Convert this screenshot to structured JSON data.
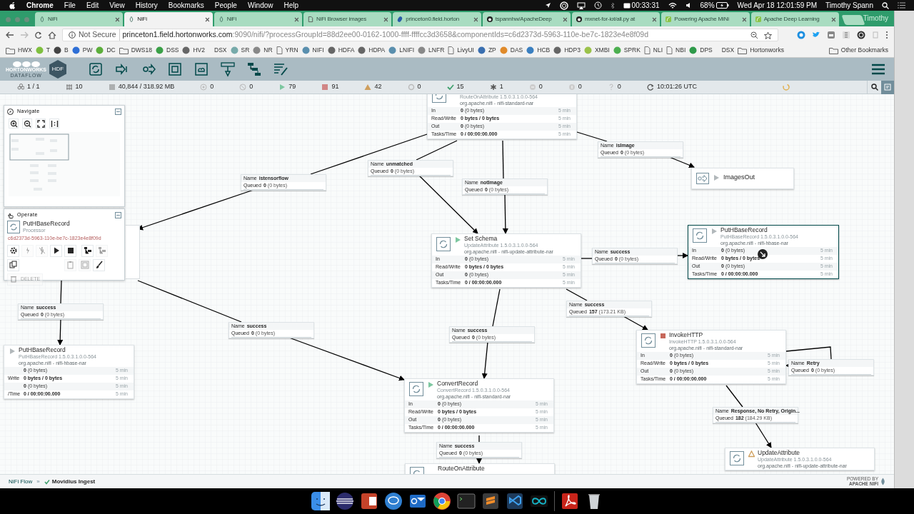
{
  "menubar": {
    "items": [
      "Chrome",
      "File",
      "Edit",
      "View",
      "History",
      "Bookmarks",
      "People",
      "Window",
      "Help"
    ],
    "timer": "00:33:31",
    "battery": "68%",
    "datetime": "Wed Apr 18  12:01:59 PM",
    "user": "Timothy Spann"
  },
  "tabs": [
    {
      "label": "NiFi",
      "selected": false,
      "kind": "nifi"
    },
    {
      "label": "NiFi",
      "selected": true,
      "kind": "nifi"
    },
    {
      "label": "NiFi",
      "selected": false,
      "kind": "nifi"
    },
    {
      "label": "NiFi Browser images",
      "selected": false,
      "kind": "page"
    },
    {
      "label": "princeton0.field.horton",
      "selected": false,
      "kind": "site"
    },
    {
      "label": "tspannhw/ApacheDeep",
      "selected": false,
      "kind": "github"
    },
    {
      "label": "mxnet-for-iot/all.py at",
      "selected": false,
      "kind": "github"
    },
    {
      "label": "Powering Apache MiNi",
      "selected": false,
      "kind": "leaf"
    },
    {
      "label": "Apache Deep Learning",
      "selected": false,
      "kind": "leaf"
    }
  ],
  "profile": "Timothy",
  "address": {
    "security": "Not Secure",
    "host": "princeton1.field.hortonworks.com",
    "path": ":9090/nifi/?processGroupId=88d2ee00-0162-1000-ffff-ffffcc3d3658&componentIds=c6d2373d-5963-110e-be7c-1823e4e8f09d"
  },
  "bookmarks": [
    {
      "label": "HWX",
      "kind": "folder"
    },
    {
      "label": "T",
      "kind": "site",
      "color": "#7fbf3f"
    },
    {
      "label": "B",
      "kind": "site",
      "color": "#444444"
    },
    {
      "label": "PW",
      "kind": "site",
      "color": "#2f6fd6"
    },
    {
      "label": "DC",
      "kind": "site",
      "color": "#5cae3b"
    },
    {
      "label": "DWS18",
      "kind": "folder"
    },
    {
      "label": "DSS",
      "kind": "site",
      "color": "#3aa047"
    },
    {
      "label": "HV2",
      "kind": "site",
      "color": "#666666"
    },
    {
      "label": "DSX",
      "kind": "text"
    },
    {
      "label": "SR",
      "kind": "site",
      "color": "#77aaaa"
    },
    {
      "label": "NR",
      "kind": "site",
      "color": "#888888"
    },
    {
      "label": "YRN",
      "kind": "page"
    },
    {
      "label": "NIFI",
      "kind": "site",
      "color": "#5a8fae"
    },
    {
      "label": "HDFA",
      "kind": "site",
      "color": "#666666"
    },
    {
      "label": "HDPA",
      "kind": "site",
      "color": "#666666"
    },
    {
      "label": "LNIFI",
      "kind": "site",
      "color": "#5a8fae"
    },
    {
      "label": "LNFR",
      "kind": "site",
      "color": "#888888"
    },
    {
      "label": "LivyUI",
      "kind": "page"
    },
    {
      "label": "ZP",
      "kind": "site",
      "color": "#3a6fb0"
    },
    {
      "label": "DAS",
      "kind": "site",
      "color": "#e08a2a"
    },
    {
      "label": "HCB",
      "kind": "site",
      "color": "#3a7fc0"
    },
    {
      "label": "HDP3",
      "kind": "site",
      "color": "#666666"
    },
    {
      "label": "XMBI",
      "kind": "site",
      "color": "#9bc24a"
    },
    {
      "label": "SPRK",
      "kind": "site",
      "color": "#4caf50"
    },
    {
      "label": "NLI",
      "kind": "page"
    },
    {
      "label": "NBI",
      "kind": "page"
    },
    {
      "label": "DPS",
      "kind": "site",
      "color": "#2e9a4a"
    },
    {
      "label": "DSX",
      "kind": "text"
    },
    {
      "label": "Hortonworks",
      "kind": "folder"
    },
    {
      "label": "Other Bookmarks",
      "kind": "folder"
    }
  ],
  "nifi": {
    "brand": "HORTONWORKS",
    "product": "DATAFLOW",
    "badge": "HDF"
  },
  "status_bar": [
    {
      "kind": "cluster",
      "text": "1 / 1"
    },
    {
      "kind": "threads",
      "text": "10"
    },
    {
      "kind": "queue",
      "text": "40,844 / 318.92 MB"
    },
    {
      "kind": "transmitting",
      "text": "0"
    },
    {
      "kind": "not-transmitting",
      "text": "0"
    },
    {
      "kind": "running",
      "text": "79"
    },
    {
      "kind": "stopped",
      "text": "91"
    },
    {
      "kind": "invalid",
      "text": "42"
    },
    {
      "kind": "disabled",
      "text": "0"
    },
    {
      "kind": "up-to-date",
      "text": "15"
    },
    {
      "kind": "modified",
      "text": "1"
    },
    {
      "kind": "stale",
      "text": "0"
    },
    {
      "kind": "stale-modified",
      "text": "0"
    },
    {
      "kind": "unknown",
      "text": "0"
    },
    {
      "kind": "refresh",
      "text": "10:01:26 UTC"
    }
  ],
  "navigate": {
    "title": "Navigate"
  },
  "operate": {
    "title": "Operate",
    "name": "PutHBaseRecord",
    "type": "Processor",
    "id": "c6d2373d-5963-110e-be7c-1823e4e8f09d",
    "buttons": [
      {
        "kind": "configure",
        "disabled": false
      },
      {
        "kind": "enable",
        "disabled": true
      },
      {
        "kind": "disable",
        "disabled": true
      },
      {
        "kind": "start",
        "disabled": false
      },
      {
        "kind": "stop",
        "disabled": false
      },
      {
        "kind": "template",
        "disabled": false
      },
      {
        "kind": "template-upload",
        "disabled": true
      },
      {
        "kind": "copy",
        "disabled": false
      },
      {
        "kind": "paste",
        "disabled": true
      },
      {
        "kind": "group",
        "disabled": true
      },
      {
        "kind": "color",
        "disabled": false
      },
      {
        "kind": "delete",
        "label": "DELETE",
        "disabled": true
      }
    ]
  },
  "processors": [
    {
      "kind": "processor",
      "selected": false,
      "type": "RouteOnAttribute 1.5.0.3.1.0.0-564",
      "bundle": "org.apache.nifi - nifi-standard-nar",
      "rows": [
        {
          "label": "In",
          "count": "0",
          "detail": "(0 bytes)",
          "time": "5 min"
        },
        {
          "label": "Read/Write",
          "count": "0 bytes / 0 bytes",
          "time": "5 min"
        },
        {
          "label": "Out",
          "count": "0",
          "detail": "(0 bytes)",
          "time": "5 min"
        },
        {
          "label": "Tasks/Time",
          "count": "0 / 00:00:00.000",
          "time": "5 min"
        }
      ]
    },
    {
      "kind": "processor",
      "selected": false,
      "running": false,
      "stopped": false,
      "invalid": false,
      "name": "PutHBaseRecord",
      "type": "PutHBaseRecord 1.5.0.3.1.0.0-564",
      "bundle": "org.apache.nifi - nifi-hbase-nar",
      "rows": [
        {
          "count": "0",
          "detail": "(0 bytes)",
          "time": "5 min"
        },
        {
          "label": "Write",
          "count": "0 bytes / 0 bytes",
          "time": "5 min"
        },
        {
          "count": "0",
          "detail": "(0 bytes)",
          "time": "5 min"
        },
        {
          "label": "/Time",
          "count": "0 / 00:00:00.000",
          "time": "5 min"
        }
      ]
    },
    {
      "kind": "processor",
      "selected": false,
      "running": true,
      "stopped": false,
      "invalid": false,
      "name": "Set Schema",
      "type": "UpdateAttribute 1.5.0.3.1.0.0-564",
      "bundle": "org.apache.nifi - nifi-update-attribute-nar",
      "rows": [
        {
          "label": "In",
          "count": "0",
          "detail": "(0 bytes)",
          "time": "5 min"
        },
        {
          "label": "Read/Write",
          "count": "0 bytes / 0 bytes",
          "time": "5 min"
        },
        {
          "label": "Out",
          "count": "0",
          "detail": "(0 bytes)",
          "time": "5 min"
        },
        {
          "label": "Tasks/Time",
          "count": "0 / 00:00:00.000",
          "time": "5 min"
        }
      ]
    },
    {
      "kind": "port",
      "selected": false,
      "running": false,
      "stopped": false,
      "invalid": false,
      "name": "ImagesOut"
    },
    {
      "kind": "processor",
      "selected": true,
      "running": false,
      "stopped": false,
      "invalid": false,
      "name": "PutHBaseRecord",
      "type": "PutHBaseRecord 1.5.0.3.1.0.0-564",
      "bundle": "org.apache.nifi - nifi-hbase-nar",
      "rows": [
        {
          "label": "In",
          "count": "0",
          "detail": "(0 bytes)",
          "time": "5 min"
        },
        {
          "label": "Read/Write",
          "count": "0 bytes / 0 bytes",
          "time": "5 min"
        },
        {
          "label": "Out",
          "count": "0",
          "detail": "(0 bytes)",
          "time": "5 min"
        },
        {
          "label": "Tasks/Time",
          "count": "0 / 00:00:00.000",
          "time": "5 min"
        }
      ]
    },
    {
      "kind": "processor",
      "selected": false,
      "running": false,
      "stopped": true,
      "invalid": false,
      "name": "InvokeHTTP",
      "type": "InvokeHTTP 1.5.0.3.1.0.0-564",
      "bundle": "org.apache.nifi - nifi-standard-nar",
      "rows": [
        {
          "label": "In",
          "count": "0",
          "detail": "(0 bytes)",
          "time": "5 min"
        },
        {
          "label": "Read/Write",
          "count": "0 bytes / 0 bytes",
          "time": "5 min"
        },
        {
          "label": "Out",
          "count": "0",
          "detail": "(0 bytes)",
          "time": "5 min"
        },
        {
          "label": "Tasks/Time",
          "count": "0 / 00:00:00.000",
          "time": "5 min"
        }
      ]
    },
    {
      "kind": "processor",
      "selected": false,
      "running": true,
      "stopped": false,
      "invalid": false,
      "name": "ConvertRecord",
      "type": "ConvertRecord 1.5.0.3.1.0.0-564",
      "bundle": "org.apache.nifi - nifi-standard-nar",
      "rows": [
        {
          "label": "In",
          "count": "0",
          "detail": "(0 bytes)",
          "time": "5 min"
        },
        {
          "label": "Read/Write",
          "count": "0 bytes / 0 bytes",
          "time": "5 min"
        },
        {
          "label": "Out",
          "count": "0",
          "detail": "(0 bytes)",
          "time": "5 min"
        },
        {
          "label": "Tasks/Time",
          "count": "0 / 00:00:00.000",
          "time": "5 min"
        }
      ]
    },
    {
      "kind": "processor",
      "selected": false,
      "name": "RouteOnAttribute"
    },
    {
      "kind": "processor",
      "selected": false,
      "running": false,
      "stopped": false,
      "invalid": true,
      "name": "UpdateAttribute",
      "type": "UpdateAttribute 1.5.0.3.1.0.0-564",
      "bundle": "org.apache.nifi - nifi-update-attribute-nar"
    }
  ],
  "connections": [
    {
      "name_label": "Name",
      "name": "isImage",
      "queued_label": "Queued",
      "count": "0",
      "size": "(0 bytes)"
    },
    {
      "name_label": "Name",
      "name": "unmatched",
      "queued_label": "Queued",
      "count": "0",
      "size": "(0 bytes)"
    },
    {
      "name_label": "Name",
      "name": "istensorflow",
      "queued_label": "Queued",
      "count": "0",
      "size": "(0 bytes)"
    },
    {
      "name_label": "Name",
      "name": "notImage",
      "queued_label": "Queued",
      "count": "0",
      "size": "(0 bytes)"
    },
    {
      "name_label": "Name",
      "name": "success",
      "queued_label": "Queued",
      "count": "0",
      "size": "(0 bytes)"
    },
    {
      "name_label": "Name",
      "name": "success",
      "queued_label": "Queued",
      "count": "157",
      "size": "(173.21 KB)"
    },
    {
      "name_label": "Name",
      "name": "success",
      "queued_label": "Queued",
      "count": "0",
      "size": "(0 bytes)"
    },
    {
      "name_label": "Name",
      "name": "success",
      "queued_label": "Queued",
      "count": "0",
      "size": "(0 bytes)"
    },
    {
      "name_label": "Name",
      "name": "success",
      "queued_label": "Queued",
      "count": "0",
      "size": "(0 bytes)"
    },
    {
      "name_label": "Name",
      "name": "Retry",
      "queued_label": "Queued",
      "count": "0",
      "size": "(0 bytes)"
    },
    {
      "name_label": "Name",
      "name": "Response, No Retry, Origin...",
      "queued_label": "Queued",
      "count": "182",
      "size": "(184.29 KB)"
    },
    {
      "name_label": "Name",
      "name": "success",
      "queued_label": "Queued",
      "count": "0",
      "size": "(0 bytes)"
    }
  ],
  "breadcrumbs": [
    {
      "label": "NiFi Flow",
      "current": false
    },
    {
      "label": "Movidius Ingest",
      "current": true
    }
  ],
  "breadcrumb_separator": "»",
  "footer_brand": {
    "top": "POWERED BY",
    "bottom": "APACHE NIFI"
  }
}
